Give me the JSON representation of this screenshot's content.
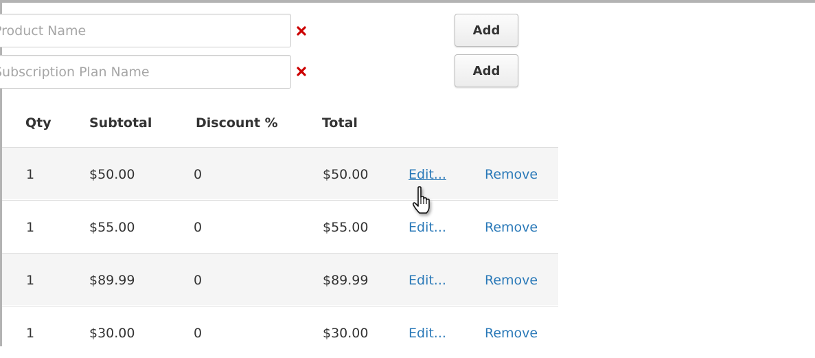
{
  "form": {
    "product_placeholder": "Product Name",
    "plan_placeholder": "Subscription Plan Name",
    "add_product_label": "Add",
    "add_plan_label": "Add",
    "clear_color": "#cc0000"
  },
  "table": {
    "headers": {
      "qty": "Qty",
      "subtotal": "Subtotal",
      "discount": "Discount %",
      "total": "Total"
    },
    "rows": [
      {
        "qty": "1",
        "subtotal": "$50.00",
        "discount": "0",
        "total": "$50.00",
        "edit": "Edit...",
        "remove": "Remove"
      },
      {
        "qty": "1",
        "subtotal": "$55.00",
        "discount": "0",
        "total": "$55.00",
        "edit": "Edit...",
        "remove": "Remove"
      },
      {
        "qty": "1",
        "subtotal": "$89.99",
        "discount": "0",
        "total": "$89.99",
        "edit": "Edit...",
        "remove": "Remove"
      },
      {
        "qty": "1",
        "subtotal": "$30.00",
        "discount": "0",
        "total": "$30.00",
        "edit": "Edit...",
        "remove": "Remove"
      }
    ]
  },
  "colors": {
    "link": "#2a79b8",
    "row_shade": "#f5f5f5"
  }
}
